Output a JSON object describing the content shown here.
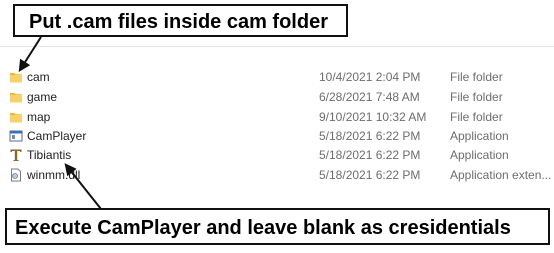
{
  "files": [
    {
      "name": "cam",
      "modified": "10/4/2021 2:04 PM",
      "type": "File folder",
      "icon": "folder-icon"
    },
    {
      "name": "game",
      "modified": "6/28/2021 7:48 AM",
      "type": "File folder",
      "icon": "folder-icon"
    },
    {
      "name": "map",
      "modified": "9/10/2021 10:32 AM",
      "type": "File folder",
      "icon": "folder-icon"
    },
    {
      "name": "CamPlayer",
      "modified": "5/18/2021 6:22 PM",
      "type": "Application",
      "icon": "application-icon"
    },
    {
      "name": "Tibiantis",
      "modified": "5/18/2021 6:22 PM",
      "type": "Application",
      "icon": "tibiantis-app-icon"
    },
    {
      "name": "winmm.dll",
      "modified": "5/18/2021 6:22 PM",
      "type": "Application exten...",
      "icon": "dll-file-icon"
    }
  ],
  "callouts": {
    "top": "Put .cam files inside cam folder",
    "bottom": "Execute CamPlayer and leave blank as cresidentials"
  },
  "colors": {
    "folder": "#f7d26b",
    "folder_shade": "#e8b93f",
    "text_primary": "#1f1f1f",
    "text_secondary": "#6d6d6d"
  }
}
